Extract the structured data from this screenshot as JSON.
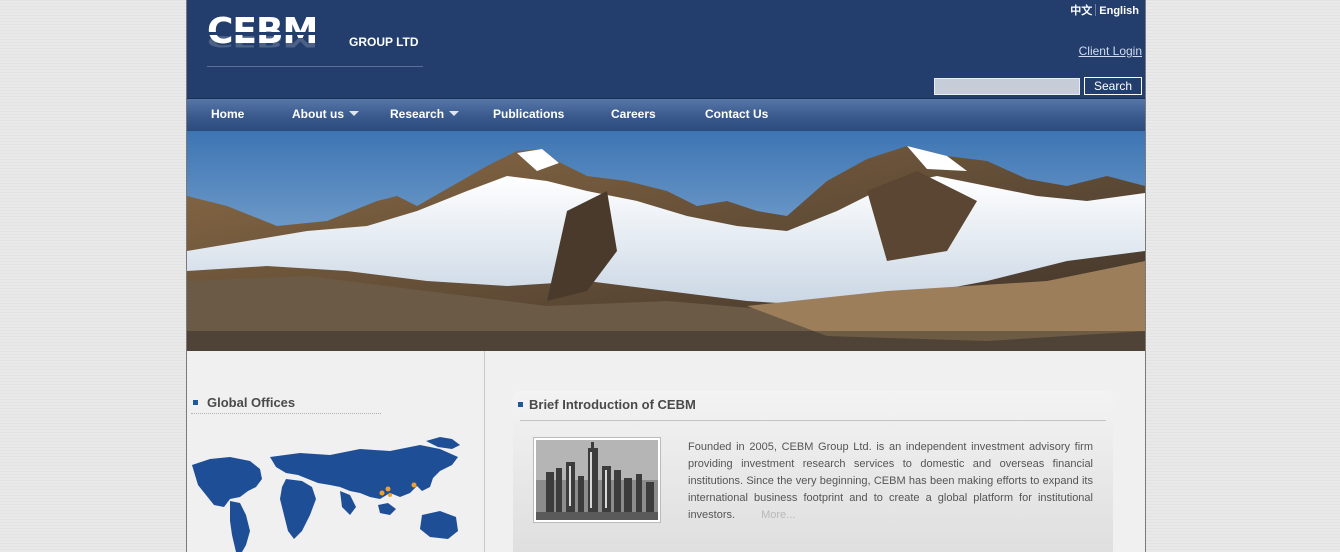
{
  "header": {
    "logo_text": "CEBM",
    "logo_subtext": "GROUP LTD",
    "lang_cn": "中文",
    "lang_en": "English",
    "client_login": "Client Login",
    "search_placeholder": "",
    "search_button": "Search"
  },
  "nav": {
    "items": [
      {
        "label": "Home",
        "dropdown": false
      },
      {
        "label": "About us",
        "dropdown": true
      },
      {
        "label": "Research",
        "dropdown": true
      },
      {
        "label": "Publications",
        "dropdown": false
      },
      {
        "label": "Careers",
        "dropdown": false
      },
      {
        "label": "Contact Us",
        "dropdown": false
      }
    ]
  },
  "banner": {
    "icon": "mountain-landscape-image"
  },
  "offices": {
    "title": "Global Offices",
    "map_icon": "world-map-image"
  },
  "intro": {
    "title": "Brief Introduction of CEBM",
    "image_icon": "city-skyline-image",
    "text": "Founded in 2005, CEBM Group Ltd. is an independent investment advisory firm providing investment research services to domestic and overseas financial institutions. Since the very beginning, CEBM has been making efforts to expand its international business footprint and to create a global platform for institutional investors.",
    "more": "More..."
  },
  "colors": {
    "header_bg": "#233e6c",
    "nav_bg": "#3a5a8e",
    "bullet": "#1e5a9a",
    "map_land": "#1e4f96",
    "map_marker": "#f0a030"
  }
}
